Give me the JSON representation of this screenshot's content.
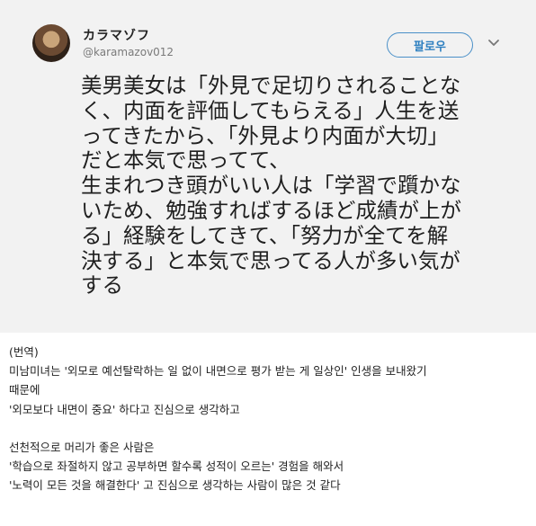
{
  "tweet": {
    "display_name": "カラマゾフ",
    "handle": "@karamazov012",
    "follow_label": "팔로우",
    "text": "美男美女は「外見で足切りされることな\nく、内面を評価してもらえる」人生を送\nってきたから、「外見より内面が大切」\nだと本気で思ってて、\n生まれつき頭がいい人は「学習で躓かな\nいため、勉強すればするほど成績が上が\nる」経験をしてきて、「努力が全てを解\n決する」と本気で思ってる人が多い気が\nする"
  },
  "translation": {
    "text": "(번역)\n미남미녀는 '외모로 예선탈락하는 일 없이 내면으로 평가 받는 게 일상인' 인생을 보내왔기\n때문에\n'외모보다 내면이 중요' 하다고 진심으로 생각하고\n\n선천적으로 머리가 좋은 사람은\n'학습으로 좌절하지 않고 공부하면 할수록 성적이 오르는' 경험을 해와서\n'노력이 모든 것을 해결한다' 고 진심으로 생각하는 사람이 많은 것 같다"
  },
  "icons": {
    "avatar": "avatar-image",
    "menu": "chevron-down-icon"
  },
  "colors": {
    "tweet_background": "#f2f2f2",
    "follow_accent": "#2d7fc0"
  }
}
